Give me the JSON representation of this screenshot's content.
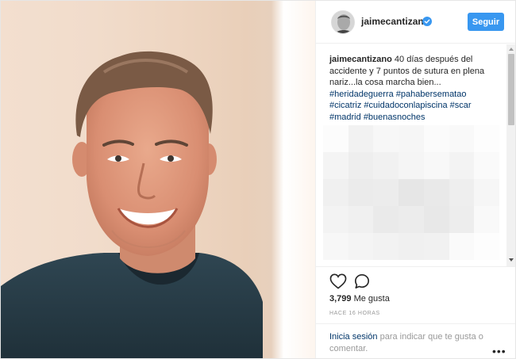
{
  "header": {
    "username": "jaimecantizano",
    "follow_label": "Seguir"
  },
  "caption": {
    "username": "jaimecantizano",
    "text": " 40 días después del accidente y 7 puntos de sutura en plena nariz...la cosa marcha bien...",
    "hashtags": [
      "#heridadeguerra",
      "#pahabersematao",
      "#cicatriz",
      "#cuidadoconlapiscina",
      "#scar",
      "#madrid",
      "#buenasnoches"
    ]
  },
  "blurred_region": {
    "colors": [
      "#fcfcfc",
      "#f2f2f2",
      "#f7f7f7",
      "#f6f6f6",
      "#fbfbfb",
      "#f9f9f9",
      "#fdfdfd",
      "#f4f4f4",
      "#eeeeee",
      "#f1f1f1",
      "#f5f5f5",
      "#f8f8f8",
      "#f3f3f3",
      "#fafafa",
      "#f0f0f0",
      "#ebebeb",
      "#ececec",
      "#e6e6e6",
      "#e9e9e9",
      "#eeeeee",
      "#f6f6f6",
      "#f3f3f3",
      "#f0f0f0",
      "#eaeaea",
      "#ececec",
      "#e8e8e8",
      "#ededed",
      "#f9f9f9",
      "#f7f7f7",
      "#f4f4f4",
      "#f2f2f2",
      "#f0f0f0",
      "#f1f1f1",
      "#fafafa",
      "#fdfdfd"
    ]
  },
  "actions": {
    "likes_count": "3,799",
    "likes_suffix": " Me gusta",
    "time_ago": "HACE 16 HORAS"
  },
  "footer": {
    "login_link": "Inicia sesión",
    "login_rest": " para indicar que te gusta o comentar.",
    "more": "•••"
  },
  "colors": {
    "accent": "#3897f0",
    "hashtag": "#003569",
    "verified": "#3897f0"
  },
  "icons": {
    "verified": "verified-badge-icon",
    "like": "heart-icon",
    "comment": "comment-bubble-icon",
    "more": "more-options-icon"
  }
}
